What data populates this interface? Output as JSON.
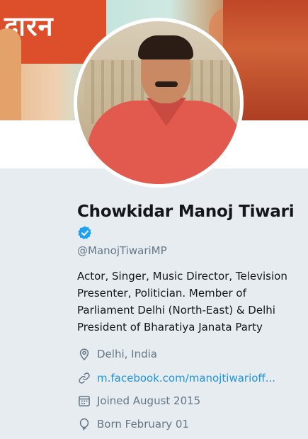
{
  "banner": {
    "text": "दारन"
  },
  "profile": {
    "name": "Chowkidar Manoj Tiwari",
    "verified": true,
    "handle": "@ManojTiwariMP",
    "bio": "Actor, Singer, Music Director, Television Presenter, Politician. Member of Parliament Delhi (North-East) & Delhi President of Bharatiya Janata Party",
    "location": "Delhi, India",
    "website": "m.facebook.com/manojtiwarioff...",
    "joined": "Joined August 2015",
    "born": "Born February 01"
  },
  "icons": {
    "verified": "verified-badge-icon",
    "location": "location-pin-icon",
    "website": "link-icon",
    "joined": "calendar-icon",
    "born": "balloon-icon"
  },
  "colors": {
    "background": "#e6ecf0",
    "link": "#1b95e0",
    "verified": "#1da1f2",
    "secondary_text": "#657786",
    "primary_text": "#14171a"
  }
}
